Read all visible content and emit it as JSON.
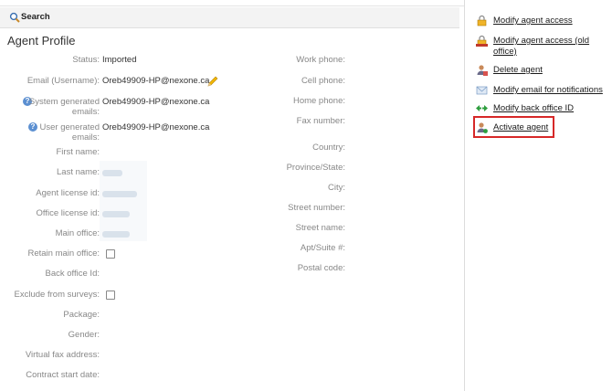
{
  "search": {
    "label": "Search"
  },
  "profile": {
    "title": "Agent Profile",
    "left_fields": [
      {
        "label": "Status:",
        "value": "Imported"
      },
      {
        "label": "Email (Username):",
        "value": "Oreb49909-HP@nexone.ca"
      },
      {
        "label": "System generated emails:",
        "value": "Oreb49909-HP@nexone.ca"
      },
      {
        "label": "User generated emails:",
        "value": "Oreb49909-HP@nexone.ca"
      },
      {
        "label": "First name:",
        "value": ""
      },
      {
        "label": "Last name:",
        "value": ""
      },
      {
        "label": "Agent license id:",
        "value": ""
      },
      {
        "label": "Office license id:",
        "value": ""
      },
      {
        "label": "Main office:",
        "value": ""
      },
      {
        "label": "Retain main office:",
        "value": ""
      },
      {
        "label": "Back office Id:",
        "value": ""
      },
      {
        "label": "Exclude from surveys:",
        "value": ""
      },
      {
        "label": "Package:",
        "value": ""
      },
      {
        "label": "Gender:",
        "value": ""
      },
      {
        "label": "Virtual fax address:",
        "value": ""
      },
      {
        "label": "Contract start date:",
        "value": ""
      }
    ],
    "right_fields": [
      {
        "label": "Work phone:"
      },
      {
        "label": "Cell phone:"
      },
      {
        "label": "Home phone:"
      },
      {
        "label": "Fax number:"
      },
      {
        "label": "Country:"
      },
      {
        "label": "Province/State:"
      },
      {
        "label": "City:"
      },
      {
        "label": "Street number:"
      },
      {
        "label": "Street name:"
      },
      {
        "label": "Apt/Suite #:"
      },
      {
        "label": "Postal code:"
      }
    ]
  },
  "actions": [
    {
      "label": "Modify agent access",
      "icon": "lock-icon"
    },
    {
      "label": "Modify agent access (old office)",
      "icon": "lock-old-icon"
    },
    {
      "label": "Delete agent",
      "icon": "user-delete-icon"
    },
    {
      "label": "Modify email for notifications",
      "icon": "envelope-icon"
    },
    {
      "label": "Modify back office ID",
      "icon": "arrows-icon"
    },
    {
      "label": "Activate agent",
      "icon": "user-activate-icon"
    }
  ],
  "colors": {
    "highlight": "#d62828",
    "help": "#5b8fd1"
  }
}
